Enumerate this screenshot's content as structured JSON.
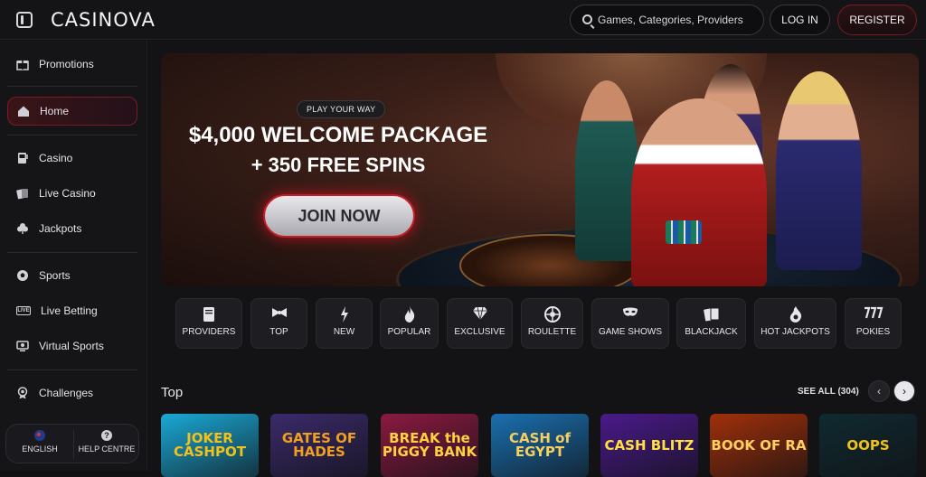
{
  "header": {
    "logo": "CASINOVA",
    "search_placeholder": "Games, Categories, Providers",
    "login_label": "LOG IN",
    "register_label": "REGISTER"
  },
  "sidebar": {
    "items": [
      {
        "label": "Promotions",
        "icon": "gift-icon"
      },
      {
        "label": "Home",
        "icon": "home-icon",
        "active": true
      },
      {
        "label": "Casino",
        "icon": "slot-machine-icon"
      },
      {
        "label": "Live Casino",
        "icon": "cards-icon"
      },
      {
        "label": "Jackpots",
        "icon": "clover-icon"
      },
      {
        "label": "Sports",
        "icon": "soccer-ball-icon"
      },
      {
        "label": "Live Betting",
        "icon": "live-icon"
      },
      {
        "label": "Virtual Sports",
        "icon": "screen-icon"
      },
      {
        "label": "Challenges",
        "icon": "medal-icon"
      }
    ],
    "language_label": "ENGLISH",
    "help_label": "HELP CENTRE",
    "help_glyph": "?",
    "live_glyph": "LIVE"
  },
  "hero": {
    "tag": "PLAY YOUR WAY",
    "title_line1": "$4,000 WELCOME PACKAGE",
    "title_line2": "+ 350 FREE SPINS",
    "cta_label": "JOIN NOW"
  },
  "categories": [
    {
      "label": "PROVIDERS",
      "icon": "book-icon"
    },
    {
      "label": "TOP",
      "icon": "bowtie-icon"
    },
    {
      "label": "NEW",
      "icon": "lightning-icon"
    },
    {
      "label": "POPULAR",
      "icon": "flame-icon"
    },
    {
      "label": "EXCLUSIVE",
      "icon": "diamond-icon"
    },
    {
      "label": "ROULETTE",
      "icon": "roulette-icon"
    },
    {
      "label": "GAME SHOWS",
      "icon": "mask-icon"
    },
    {
      "label": "BLACKJACK",
      "icon": "playing-cards-icon"
    },
    {
      "label": "HOT JACKPOTS",
      "icon": "hot-jackpot-icon"
    },
    {
      "label": "POKIES",
      "icon": "sevens-icon"
    }
  ],
  "top_section": {
    "title": "Top",
    "see_all": "SEE ALL (304)",
    "prev_glyph": "‹",
    "next_glyph": "›",
    "games": [
      {
        "name": "JOKER CASHPOT",
        "bg": "#1aa9d6",
        "fg": "#f3c21a"
      },
      {
        "name": "GATES OF HADES",
        "bg": "#3a2a6a",
        "fg": "#f0a020"
      },
      {
        "name": "BREAK the PIGGY BANK",
        "bg": "#8a1a40",
        "fg": "#ffd040"
      },
      {
        "name": "CASH of EGYPT",
        "bg": "#1a70b0",
        "fg": "#f5d060"
      },
      {
        "name": "CASH BLITZ",
        "bg": "#4a1a8a",
        "fg": "#ffe040"
      },
      {
        "name": "BOOK OF RA",
        "bg": "#a0300a",
        "fg": "#ffd060"
      },
      {
        "name": "OOPS",
        "bg": "#0f2a30",
        "fg": "#f0c020"
      }
    ]
  }
}
